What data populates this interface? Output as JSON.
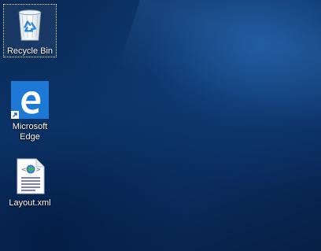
{
  "desktop": {
    "icons": [
      {
        "label": "Recycle Bin",
        "icon": "recycle-bin-icon",
        "selected": true
      },
      {
        "label": "Microsoft Edge",
        "label_line1": "Microsoft",
        "label_line2": "Edge",
        "icon": "edge-icon",
        "shortcut": true
      },
      {
        "label": "Layout.xml",
        "icon": "xml-file-icon"
      }
    ]
  },
  "colors": {
    "wallpaper": "#0b3366",
    "edge_tile": "#1e78d6",
    "label_text": "#ffffff"
  }
}
